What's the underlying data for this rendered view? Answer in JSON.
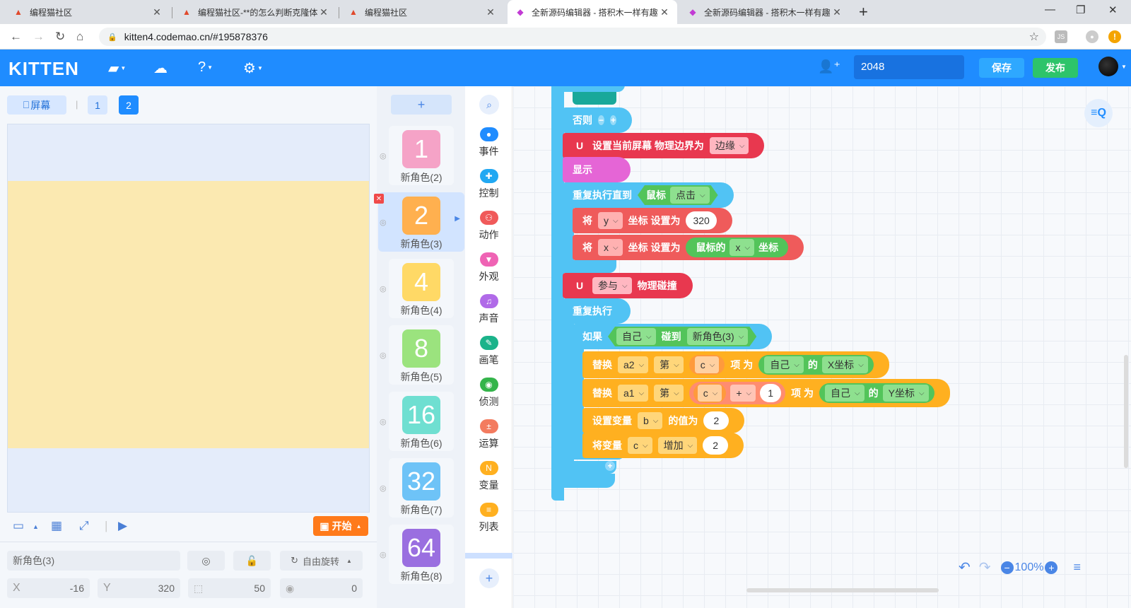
{
  "browser": {
    "tabs": [
      {
        "title": "编程猫社区",
        "active": false
      },
      {
        "title": "编程猫社区-**的怎么判断克隆体",
        "active": false
      },
      {
        "title": "编程猫社区",
        "active": false
      },
      {
        "title": "全新源码编辑器 - 搭积木一样有趣",
        "active": true
      },
      {
        "title": "全新源码编辑器 - 搭积木一样有趣",
        "active": false
      }
    ],
    "url": "kitten4.codemao.cn/#195878376",
    "ext_js": "JS"
  },
  "app": {
    "logo": "KITTEN",
    "project_name": "2048",
    "save_label": "保存",
    "publish_label": "发布"
  },
  "stage": {
    "screen_label": "屏幕",
    "screens": [
      "1",
      "2"
    ],
    "active_screen": "2",
    "start_label": "开始",
    "sprite_name": "新角色(3)",
    "rotation_label": "自由旋转",
    "x_label": "X",
    "x_value": "-16",
    "y_label": "Y",
    "y_value": "320",
    "size_value": "50",
    "rotation_value": "0"
  },
  "sprites": [
    {
      "num": "1",
      "name": "新角色(2)",
      "color": "#f5a3c7"
    },
    {
      "num": "2",
      "name": "新角色(3)",
      "color": "#ffb04f",
      "selected": true
    },
    {
      "num": "4",
      "name": "新角色(4)",
      "color": "#ffd966"
    },
    {
      "num": "8",
      "name": "新角色(5)",
      "color": "#9be37e"
    },
    {
      "num": "16",
      "name": "新角色(6)",
      "color": "#6fdfd1"
    },
    {
      "num": "32",
      "name": "新角色(7)",
      "color": "#6ec3f7"
    },
    {
      "num": "64",
      "name": "新角色(8)",
      "color": "#9a6fe0"
    }
  ],
  "categories": [
    {
      "label": "事件",
      "color": "#1f8cff"
    },
    {
      "label": "控制",
      "color": "#21a8f2"
    },
    {
      "label": "动作",
      "color": "#f05a5a"
    },
    {
      "label": "外观",
      "color": "#ef63b4"
    },
    {
      "label": "声音",
      "color": "#b06ae8"
    },
    {
      "label": "画笔",
      "color": "#1bb38a"
    },
    {
      "label": "侦测",
      "color": "#34b44a"
    },
    {
      "label": "运算",
      "color": "#f37b5f"
    },
    {
      "label": "变量",
      "color": "#ffb020"
    },
    {
      "label": "列表",
      "color": "#ffb020"
    }
  ],
  "blocks": {
    "else_label": "否则",
    "set_border": {
      "text": "设置当前屏幕 物理边界为",
      "dd": "边缘"
    },
    "show": "显示",
    "repeat_until": {
      "text": "重复执行直到",
      "cond_label": "鼠标",
      "cond_dd": "点击"
    },
    "set_y": {
      "t1": "将",
      "dd": "y",
      "t2": "坐标 设置为",
      "val": "320"
    },
    "set_x": {
      "t1": "将",
      "dd": "x",
      "t2": "坐标 设置为",
      "r1": "鼠标的",
      "rdd": "x",
      "r2": "坐标"
    },
    "physics": {
      "dd": "参与",
      "text": "物理碰撞"
    },
    "forever": "重复执行",
    "if_touch": {
      "t1": "如果",
      "dd1": "自己",
      "t2": "碰到",
      "dd2": "新角色(3)"
    },
    "replace1": {
      "t1": "替换",
      "dd1": "a2",
      "dd2": "第",
      "dd3": "c",
      "t2": "项 为",
      "dd4": "自己",
      "t3": "的",
      "dd5": "X坐标"
    },
    "replace2": {
      "t1": "替换",
      "dd1": "a1",
      "dd2": "第",
      "dd3": "c",
      "dd4": "+",
      "val": "1",
      "t2": "项 为",
      "dd5": "自己",
      "t3": "的",
      "dd6": "Y坐标"
    },
    "setvar": {
      "t1": "设置变量",
      "dd": "b",
      "t2": "的值为",
      "val": "2"
    },
    "changevar": {
      "t1": "将变量",
      "dd1": "c",
      "dd2": "增加",
      "val": "2"
    }
  },
  "zoom": "100%"
}
